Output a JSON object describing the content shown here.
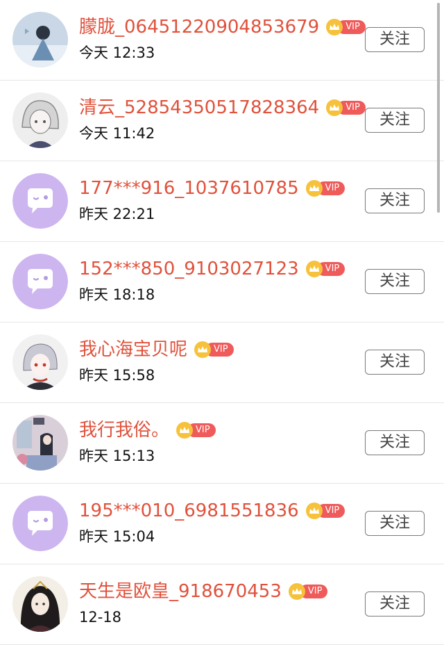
{
  "follow_label": "关注",
  "vip_label": "VIP",
  "users": [
    {
      "name": "朦胧_06451220904853679",
      "time": "今天 12:33",
      "avatar": "anime-avatar-winter"
    },
    {
      "name": "清云_52854350517828364",
      "time": "今天 11:42",
      "avatar": "anime-avatar-white-hair"
    },
    {
      "name": "177***916_1037610785",
      "time": "昨天 22:21",
      "avatar": "default-chat-avatar"
    },
    {
      "name": "152***850_9103027123",
      "time": "昨天 18:18",
      "avatar": "default-chat-avatar"
    },
    {
      "name": "我心海宝贝呢",
      "time": "昨天 15:58",
      "avatar": "anime-avatar-silver-hair"
    },
    {
      "name": "我行我俗。",
      "time": "昨天 15:13",
      "avatar": "illustration-avatar-room"
    },
    {
      "name": "195***010_6981551836",
      "time": "昨天 15:04",
      "avatar": "default-chat-avatar"
    },
    {
      "name": "天生是欧皇_918670453",
      "time": "12-18",
      "avatar": "anime-avatar-dark-hair"
    }
  ],
  "colors": {
    "name": "#e0513b",
    "vip_pill": "#ef5a5a",
    "crown": "#f7c23b",
    "default_avatar": "#cdb6f0"
  }
}
